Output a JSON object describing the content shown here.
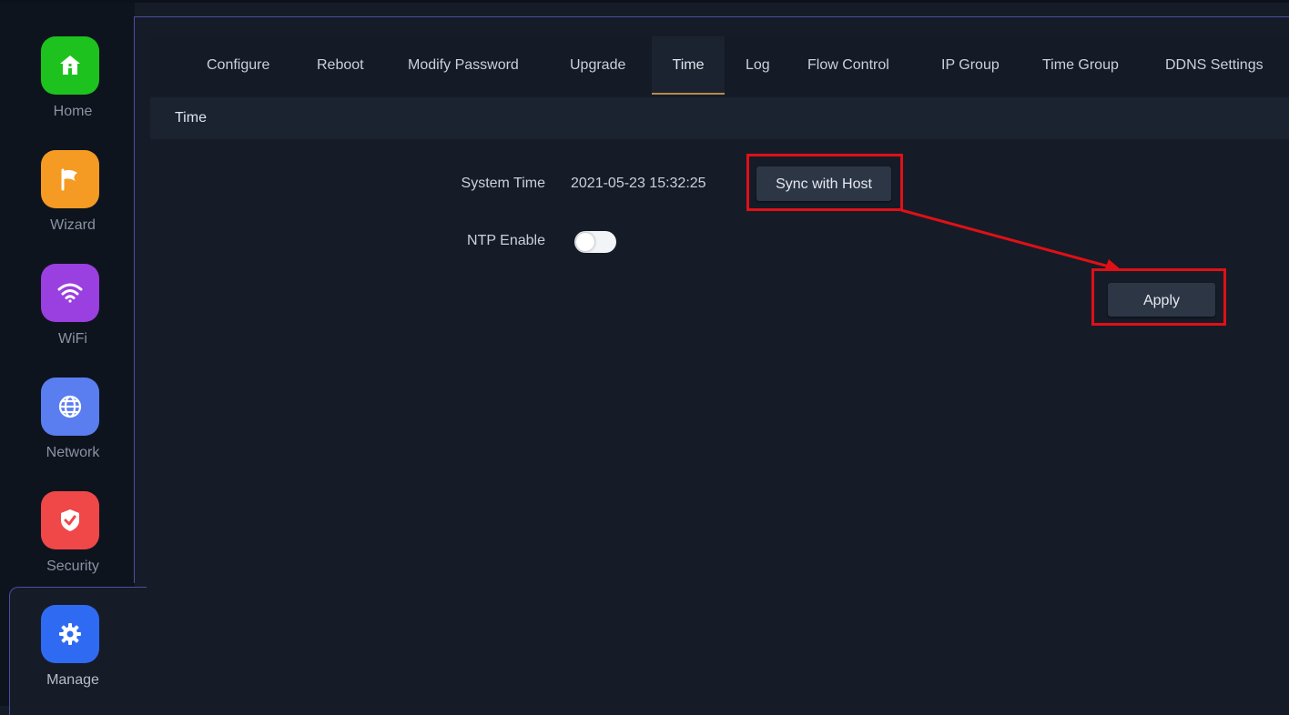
{
  "sidebar": {
    "items": [
      {
        "label": "Home",
        "icon": "home-icon",
        "color": "#1ec21e"
      },
      {
        "label": "Wizard",
        "icon": "flag-icon",
        "color": "#f59a23"
      },
      {
        "label": "WiFi",
        "icon": "wifi-icon",
        "color": "#9a3fe0"
      },
      {
        "label": "Network",
        "icon": "globe-icon",
        "color": "#5a7ef0"
      },
      {
        "label": "Security",
        "icon": "shield-icon",
        "color": "#f04848"
      },
      {
        "label": "Manage",
        "icon": "gear-icon",
        "color": "#2f6bf2"
      }
    ],
    "active": "Manage"
  },
  "tabs": [
    {
      "label": "Configure"
    },
    {
      "label": "Reboot"
    },
    {
      "label": "Modify Password"
    },
    {
      "label": "Upgrade"
    },
    {
      "label": "Time"
    },
    {
      "label": "Log"
    },
    {
      "label": "Flow Control"
    },
    {
      "label": "IP Group"
    },
    {
      "label": "Time Group"
    },
    {
      "label": "DDNS Settings"
    }
  ],
  "active_tab": "Time",
  "section": {
    "title": "Time"
  },
  "form": {
    "system_time_label": "System Time",
    "system_time_value": "2021-05-23 15:32:25",
    "sync_button": "Sync with Host",
    "ntp_label": "NTP Enable",
    "ntp_enabled": false,
    "apply_button": "Apply"
  },
  "annotation_color": "#e01016"
}
